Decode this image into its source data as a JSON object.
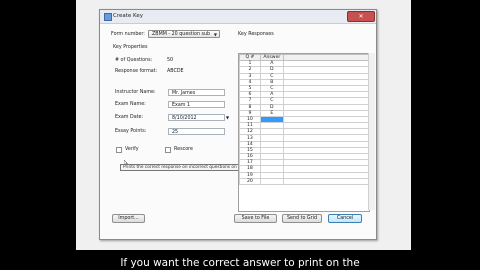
{
  "window": {
    "title": "Create Key",
    "close_glyph": "✕"
  },
  "form": {
    "form_number_label": "Form number:",
    "form_number_value": "ZBMM - 20 question sub",
    "key_properties_label": "Key Properties",
    "num_questions_label": "# of Questions:",
    "num_questions_value": "50",
    "response_format_label": "Response format:",
    "response_format_value": "ABCDE",
    "instructor_label": "Instructor Name:",
    "instructor_value": "Mr. James",
    "exam_name_label": "Exam Name:",
    "exam_name_value": "Exam 1",
    "exam_date_label": "Exam Date:",
    "exam_date_value": "8/10/2012",
    "essay_points_label": "Essay Points:",
    "essay_points_value": "25",
    "verify_label": "Verify",
    "rescore_label": "Rescore"
  },
  "tooltip": {
    "text": "Prints the correct response on incorrect questions on a scanned form..."
  },
  "key_responses": {
    "label": "Key Responses",
    "col_q": "Q #",
    "col_answer": "Answer",
    "rows": [
      {
        "q": "1",
        "a": "A"
      },
      {
        "q": "2",
        "a": "D"
      },
      {
        "q": "3",
        "a": "C"
      },
      {
        "q": "4",
        "a": "B"
      },
      {
        "q": "5",
        "a": "C"
      },
      {
        "q": "6",
        "a": "A"
      },
      {
        "q": "7",
        "a": "C"
      },
      {
        "q": "8",
        "a": "D"
      },
      {
        "q": "9",
        "a": "E"
      },
      {
        "q": "10",
        "a": ""
      },
      {
        "q": "11",
        "a": ""
      },
      {
        "q": "12",
        "a": ""
      },
      {
        "q": "13",
        "a": ""
      },
      {
        "q": "14",
        "a": ""
      },
      {
        "q": "15",
        "a": ""
      },
      {
        "q": "16",
        "a": ""
      },
      {
        "q": "17",
        "a": ""
      },
      {
        "q": "18",
        "a": ""
      },
      {
        "q": "19",
        "a": ""
      },
      {
        "q": "20",
        "a": ""
      }
    ]
  },
  "buttons": {
    "import": "Import...",
    "save_to_file": "Save to File",
    "send_to_grid": "Send to Grid",
    "cancel": "Cancel"
  },
  "caption": {
    "text": "If you want the correct answer to print on the"
  },
  "colors": {
    "selected_cell": "#3399ff"
  }
}
